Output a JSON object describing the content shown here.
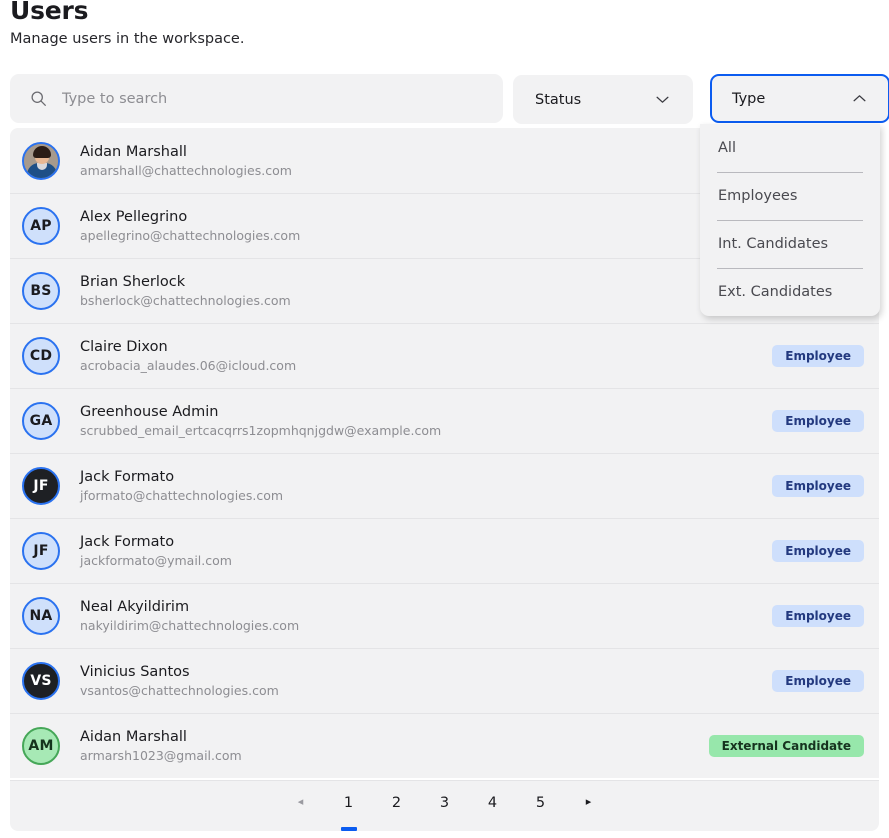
{
  "header": {
    "title": "Users",
    "subtitle": "Manage users in the workspace."
  },
  "search": {
    "placeholder": "Type to search",
    "value": "",
    "icon": "search-icon"
  },
  "filters": {
    "status": {
      "label": "Status",
      "expanded": false,
      "icon": "chevron-down-icon"
    },
    "type": {
      "label": "Type",
      "expanded": true,
      "icon": "chevron-up-icon",
      "options": [
        "All",
        "Employees",
        "Int. Candidates",
        "Ext. Candidates"
      ]
    }
  },
  "colors": {
    "accent": "#0b5cf0",
    "panel": "#f2f2f3",
    "employee_badge_bg": "#cedffc",
    "employee_badge_text": "#23397f",
    "external_badge_bg": "#97e7ab",
    "external_badge_text": "#16331f",
    "avatar_ring": "#2a72f0",
    "avatar_blue_fill": "#cfe0fb",
    "avatar_dark_fill": "#1e2024",
    "avatar_green_fill": "#a7e9b5",
    "avatar_green_ring": "#46a758"
  },
  "users": [
    {
      "name": "Aidan Marshall",
      "email": "amarshall@chattechnologies.com",
      "initials": "",
      "avatar_style": "photo",
      "badge": "",
      "badge_visible": false
    },
    {
      "name": "Alex Pellegrino",
      "email": "apellegrino@chattechnologies.com",
      "initials": "AP",
      "avatar_style": "blue",
      "badge": "",
      "badge_visible": false
    },
    {
      "name": "Brian Sherlock",
      "email": "bsherlock@chattechnologies.com",
      "initials": "BS",
      "avatar_style": "blue",
      "badge": "",
      "badge_visible": false
    },
    {
      "name": "Claire Dixon",
      "email": "acrobacia_alaudes.06@icloud.com",
      "initials": "CD",
      "avatar_style": "blue",
      "badge": "Employee",
      "badge_visible": true
    },
    {
      "name": "Greenhouse Admin",
      "email": "scrubbed_email_ertcacqrrs1zopmhqnjgdw@example.com",
      "initials": "GA",
      "avatar_style": "blue",
      "badge": "Employee",
      "badge_visible": true
    },
    {
      "name": "Jack Formato",
      "email": "jformato@chattechnologies.com",
      "initials": "JF",
      "avatar_style": "dark",
      "badge": "Employee",
      "badge_visible": true
    },
    {
      "name": "Jack Formato",
      "email": "jackformato@ymail.com",
      "initials": "JF",
      "avatar_style": "blue",
      "badge": "Employee",
      "badge_visible": true
    },
    {
      "name": "Neal Akyildirim",
      "email": "nakyildirim@chattechnologies.com",
      "initials": "NA",
      "avatar_style": "blue",
      "badge": "Employee",
      "badge_visible": true
    },
    {
      "name": "Vinicius Santos",
      "email": "vsantos@chattechnologies.com",
      "initials": "VS",
      "avatar_style": "dark",
      "badge": "Employee",
      "badge_visible": true
    },
    {
      "name": "Aidan Marshall",
      "email": "armarsh1023@gmail.com",
      "initials": "AM",
      "avatar_style": "green",
      "badge": "External Candidate",
      "badge_visible": true
    }
  ],
  "pagination": {
    "prev": "◂",
    "next": "▸",
    "prev_disabled": true,
    "pages": [
      "1",
      "2",
      "3",
      "4",
      "5"
    ],
    "current": "1"
  }
}
